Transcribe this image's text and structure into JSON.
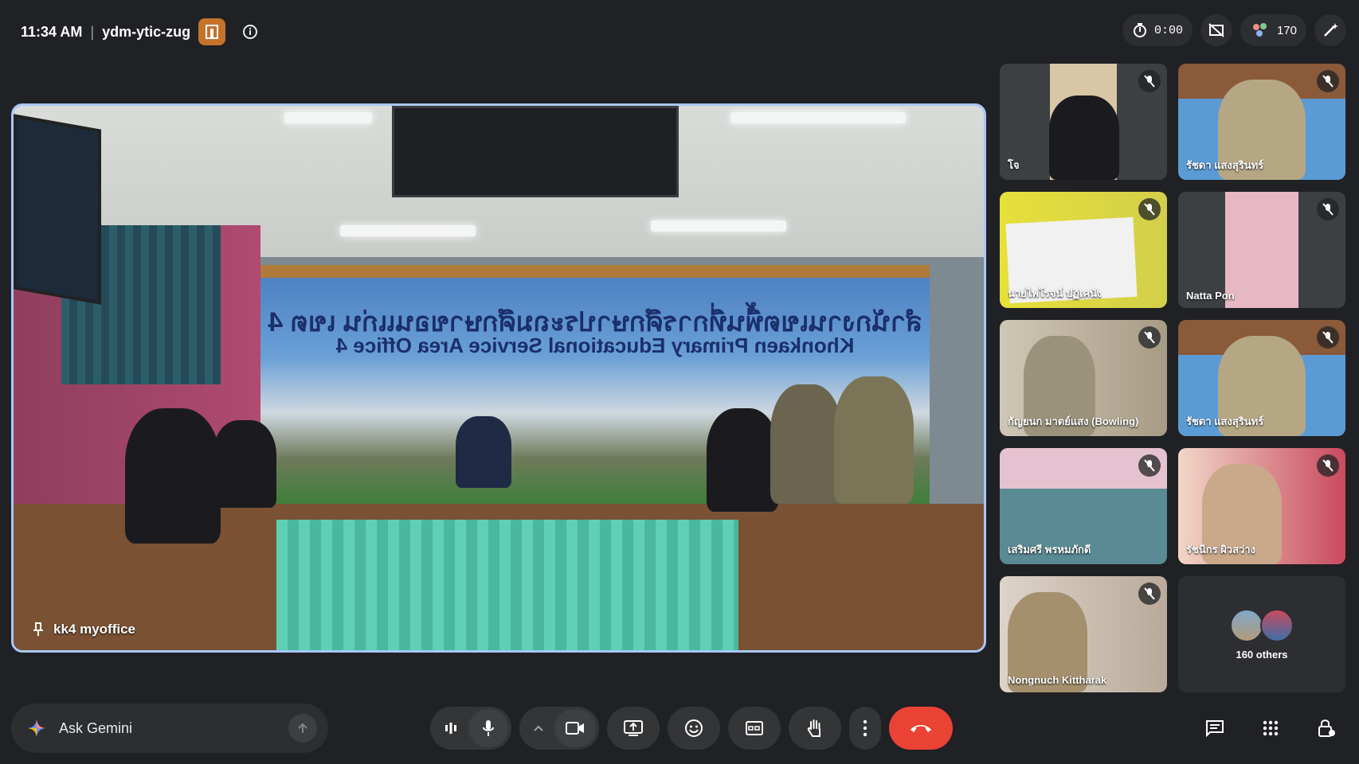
{
  "header": {
    "time": "11:34 AM",
    "separator": "|",
    "meeting_code": "ydm-ytic-zug"
  },
  "status": {
    "timer": "0:00",
    "participant_count": "170"
  },
  "main_video": {
    "participant_name": "kk4 myoffice",
    "banner_line1": "สำนักงานเขตพื้นที่การศึกษาประถมศึกษาขอนแก่น เขต 4",
    "banner_line2": "Khonkaen Primary Educational Service Area Office 4"
  },
  "tiles": [
    {
      "name": "โจ",
      "muted": true
    },
    {
      "name": "รัชดา แสงสุรินทร์",
      "muted": true
    },
    {
      "name": "นายไพโรจน์ ปฏิเคนัง",
      "muted": true
    },
    {
      "name": "Natta Pon",
      "muted": true
    },
    {
      "name": "กัญยนก มาตย์แสง (Bowling)",
      "muted": true
    },
    {
      "name": "รัชดา แสงสุรินทร์",
      "muted": true
    },
    {
      "name": "เสริมศรี พรหมภักดี",
      "muted": true
    },
    {
      "name": "รัชนีกร ผิวสว่าง",
      "muted": true
    },
    {
      "name": "Nongnuch Kittharak",
      "muted": true
    }
  ],
  "others_tile": {
    "label": "160 others"
  },
  "bottom_bar": {
    "gemini_label": "Ask Gemini"
  },
  "colors": {
    "background": "#202124",
    "active_speaker_border": "#a8c7fa",
    "end_call": "#ea4335",
    "room_badge": "#c5722b"
  }
}
